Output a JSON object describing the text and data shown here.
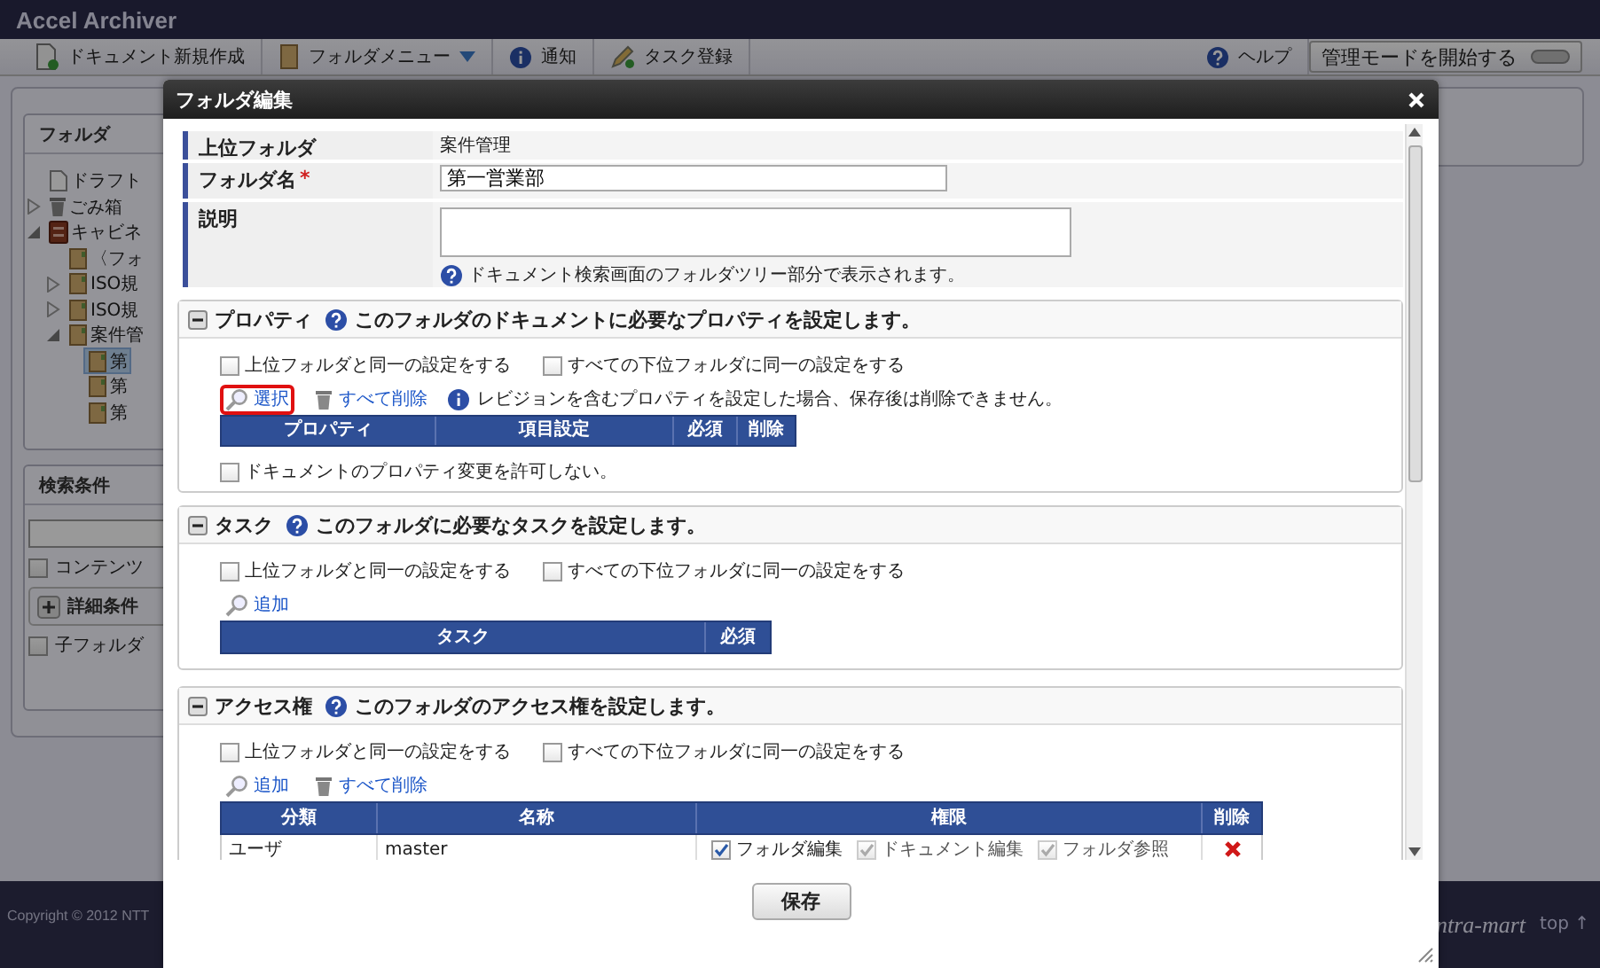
{
  "app": {
    "title": "Accel Archiver"
  },
  "toolbar": {
    "items": [
      {
        "kind": "document",
        "label": "ドキュメント新規作成"
      },
      {
        "kind": "folder",
        "label": "フォルダメニュー",
        "dropdown": true
      },
      {
        "kind": "info",
        "label": "通知"
      },
      {
        "kind": "task",
        "label": "タスク登録"
      }
    ],
    "right": [
      {
        "kind": "help",
        "label": "ヘルプ"
      },
      {
        "kind": "mode",
        "label": "管理モードを開始する",
        "on": false
      }
    ]
  },
  "sidebar": {
    "folder_panel": {
      "title": "フォルダ",
      "tree": [
        {
          "kind": "draft",
          "label": "ドラフト",
          "selected": false
        },
        {
          "kind": "trash",
          "label": "ごみ箱",
          "expanded": false,
          "selected": false
        },
        {
          "kind": "cabinet",
          "label": "キャビネ",
          "expanded": true,
          "selected": false,
          "children": [
            {
              "kind": "folder",
              "label": "〈フォ",
              "selected": false
            },
            {
              "kind": "folder",
              "label": "ISO規",
              "expanded": false,
              "selected": false
            },
            {
              "kind": "folder",
              "label": "ISO規",
              "expanded": false,
              "selected": false
            },
            {
              "kind": "folder",
              "label": "案件管",
              "expanded": true,
              "selected": false,
              "children": [
                {
                  "kind": "folder",
                  "label": "第",
                  "selected": true
                },
                {
                  "kind": "folder",
                  "label": "第",
                  "selected": false
                },
                {
                  "kind": "folder",
                  "label": "第",
                  "selected": false
                }
              ]
            }
          ]
        }
      ]
    },
    "search_panel": {
      "title": "検索条件",
      "options": [
        {
          "kind": "checkbox",
          "label": "コンテンツ",
          "checked": false
        },
        {
          "kind": "button",
          "label": "詳細条件"
        },
        {
          "kind": "checkbox",
          "label": "子フォルダ",
          "checked": false
        }
      ]
    }
  },
  "footer": {
    "copyright": "Copyright © 2012 NTT",
    "logo": "ntra-mart",
    "top_link": "top ↑"
  },
  "dialog": {
    "title": "フォルダ編集",
    "fields": [
      {
        "kind": "text",
        "label": "上位フォルダ",
        "value": "案件管理"
      },
      {
        "kind": "input",
        "label": "フォルダ名",
        "required_mark": "*",
        "value": "第一営業部"
      },
      {
        "kind": "textarea",
        "label": "説明",
        "help": "ドキュメント検索画面のフォルダツリー部分で表示されます。"
      }
    ],
    "sections": [
      {
        "title": "プロパティ",
        "expanded": true,
        "description": "このフォルダのドキュメントに必要なプロパティを設定します。",
        "options": [
          {
            "label": "上位フォルダと同一の設定をする",
            "checked": false
          },
          {
            "label": "すべての下位フォルダに同一の設定をする",
            "checked": false
          }
        ],
        "actions": [
          {
            "kind": "select",
            "label": "選択",
            "highlighted": true
          },
          {
            "kind": "delete-all",
            "label": "すべて削除",
            "highlighted": false
          }
        ],
        "note": "レビジョンを含むプロパティを設定した場合、保存後は削除できません。",
        "table": {
          "columns": [
            "プロパティ",
            "項目設定",
            "必須",
            "削除"
          ]
        },
        "footer_options": [
          {
            "label": "ドキュメントのプロパティ変更を許可しない。",
            "checked": false
          }
        ]
      },
      {
        "title": "タスク",
        "expanded": true,
        "description": "このフォルダに必要なタスクを設定します。",
        "options": [
          {
            "label": "上位フォルダと同一の設定をする",
            "checked": false
          },
          {
            "label": "すべての下位フォルダに同一の設定をする",
            "checked": false
          }
        ],
        "actions": [
          {
            "kind": "add",
            "label": "追加",
            "highlighted": false
          }
        ],
        "table": {
          "columns": [
            "タスク",
            "必須"
          ]
        }
      },
      {
        "title": "アクセス権",
        "expanded": true,
        "description": "このフォルダのアクセス権を設定します。",
        "options": [
          {
            "label": "上位フォルダと同一の設定をする",
            "checked": false
          },
          {
            "label": "すべての下位フォルダに同一の設定をする",
            "checked": false
          }
        ],
        "actions": [
          {
            "kind": "add",
            "label": "追加",
            "highlighted": false
          },
          {
            "kind": "delete-all",
            "label": "すべて削除",
            "highlighted": false
          }
        ],
        "table": {
          "columns": [
            "分類",
            "名称",
            "権限",
            "削除"
          ],
          "rows": [
            {
              "cells": [
                {
                  "kind": "text",
                  "text": "ユーザ"
                },
                {
                  "kind": "text",
                  "text": "master"
                },
                {
                  "kind": "permissions",
                  "items": [
                    {
                      "label": "フォルダ編集",
                      "checked": true,
                      "disabled": false
                    },
                    {
                      "label": "ドキュメント編集",
                      "checked": true,
                      "disabled": true
                    },
                    {
                      "label": "フォルダ参照",
                      "checked": true,
                      "disabled": true
                    }
                  ]
                },
                {
                  "kind": "delete"
                }
              ]
            }
          ]
        }
      }
    ],
    "save_button": "保存"
  }
}
